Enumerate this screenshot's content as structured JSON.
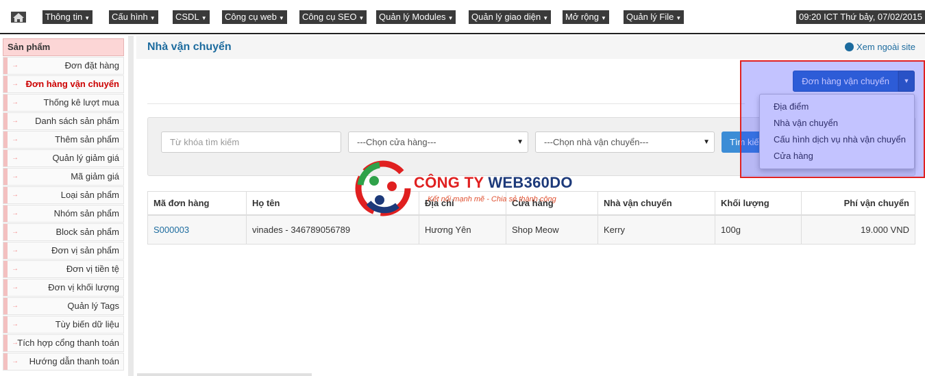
{
  "topnav": {
    "items": [
      "Thông tin",
      "Cấu hình",
      "CSDL",
      "Công cụ web",
      "Công cụ SEO",
      "Quản lý Modules",
      "Quản lý giao diện",
      "Mở rộng",
      "Quản lý File"
    ],
    "clock": "09:20 ICT Thứ bảy, 07/02/2015"
  },
  "sidebar": {
    "heading": "Sản phẩm",
    "items": [
      "Đơn đặt hàng",
      "Đơn hàng vận chuyển",
      "Thống kê lượt mua",
      "Danh sách sản phẩm",
      "Thêm sản phẩm",
      "Quản lý giảm giá",
      "Mã giảm giá",
      "Loại sản phẩm",
      "Nhóm sản phẩm",
      "Block sản phẩm",
      "Đơn vị sản phẩm",
      "Đơn vị tiền tệ",
      "Đơn vị khối lượng",
      "Quản lý Tags",
      "Tùy biến dữ liệu",
      "Tích hợp cổng thanh toán",
      "Hướng dẫn thanh toán"
    ],
    "active_index": 1
  },
  "header": {
    "title": "Nhà vận chuyển",
    "site_link": "Xem ngoài site"
  },
  "action": {
    "button_label": "Đơn hàng vận chuyển",
    "dropdown": [
      "Địa điểm",
      "Nhà vận chuyển",
      "Cấu hình dịch vụ nhà vận chuyển",
      "Cửa hàng"
    ]
  },
  "filter": {
    "keyword_placeholder": "Từ khóa tìm kiếm",
    "store_select": "---Chọn cửa hàng---",
    "carrier_select": "---Chọn nhà vận chuyển---",
    "search_button": "Tìm kiếm"
  },
  "table": {
    "columns": [
      "Mã đơn hàng",
      "Họ tên",
      "Địa chỉ",
      "Cửa hàng",
      "Nhà vận chuyển",
      "Khối lượng",
      "Phí vận chuyển"
    ],
    "rows": [
      [
        "S000003",
        "vinades - 346789056789",
        "Hương Yên",
        "Shop Meow",
        "Kerry",
        "100g",
        "19.000 VND"
      ]
    ]
  },
  "watermark": {
    "company": "CÔNG TY",
    "brand": "WEB360DO",
    "slogan": "Kết nối mạnh mẽ - Chia sẻ thành công"
  },
  "colors": {
    "link": "#1c6b9e",
    "primary_button": "#3071c8",
    "highlight_border": "#e02020",
    "active_sidebar": "#cc0000"
  }
}
